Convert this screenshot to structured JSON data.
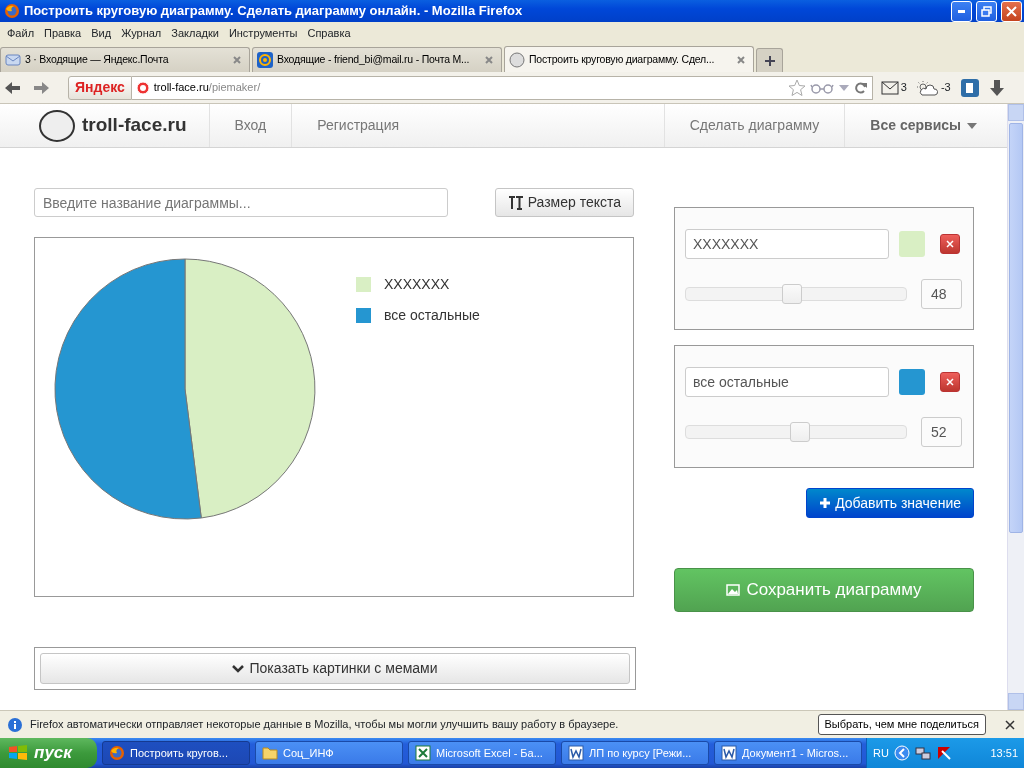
{
  "window": {
    "title": "Построить круговую диаграмму. Сделать диаграмму онлайн. - Mozilla Firefox"
  },
  "menu": [
    "Файл",
    "Правка",
    "Вид",
    "Журнал",
    "Закладки",
    "Инструменты",
    "Справка"
  ],
  "tabs": [
    {
      "label": "3 · Входящие — Яндекс.Почта",
      "kind": "mail",
      "selected": false
    },
    {
      "label": "Входящие - friend_bi@mail.ru - Почта М...",
      "kind": "at",
      "selected": false
    },
    {
      "label": "Построить круговую диаграмму. Сдел...",
      "kind": "site",
      "selected": true
    }
  ],
  "toolbar": {
    "search_engine": "Яндекс",
    "url_host": "troll-face.ru",
    "url_path": "/piemaker/",
    "mail_count": "3",
    "weather": "-3"
  },
  "site_nav": {
    "brand": "troll-face.ru",
    "links": [
      "Вход",
      "Регистрация"
    ],
    "right_links": [
      "Сделать диаграмму",
      "Все сервисы"
    ]
  },
  "editor": {
    "title_placeholder": "Введите название диаграммы...",
    "text_size_button": "Размер текста",
    "chart_data": {
      "type": "pie",
      "legend": "right",
      "categories": [
        "XXXXXXX",
        "все остальные"
      ],
      "values": [
        48,
        52
      ]
    },
    "entries": [
      {
        "label": "XXXXXXX",
        "color": "#d9efc4",
        "level": 0.48,
        "value": "48"
      },
      {
        "label": "все остальные",
        "color": "#2596d1",
        "level": 0.52,
        "value": "52"
      }
    ],
    "add_button": "Добавить значение",
    "save_button": "Сохранить диаграмму",
    "memes_button": "Показать картинки с мемами"
  },
  "notification": {
    "text": "Firefox автоматически отправляет некоторые данные в Mozilla, чтобы мы могли улучшить вашу работу в браузере.",
    "button": "Выбрать, чем мне поделиться"
  },
  "taskbar": {
    "start": "пуск",
    "items": [
      {
        "label": "Построить кругов...",
        "kind": "firefox",
        "selected": true
      },
      {
        "label": "Соц_ИНФ",
        "kind": "folder",
        "selected": false
      },
      {
        "label": "Microsoft Excel - Ба...",
        "kind": "excel",
        "selected": false
      },
      {
        "label": "ЛП по курсу [Режи...",
        "kind": "word",
        "selected": false
      },
      {
        "label": "Документ1 - Micros...",
        "kind": "word",
        "selected": false
      }
    ],
    "language": "RU",
    "clock": "13:51"
  }
}
